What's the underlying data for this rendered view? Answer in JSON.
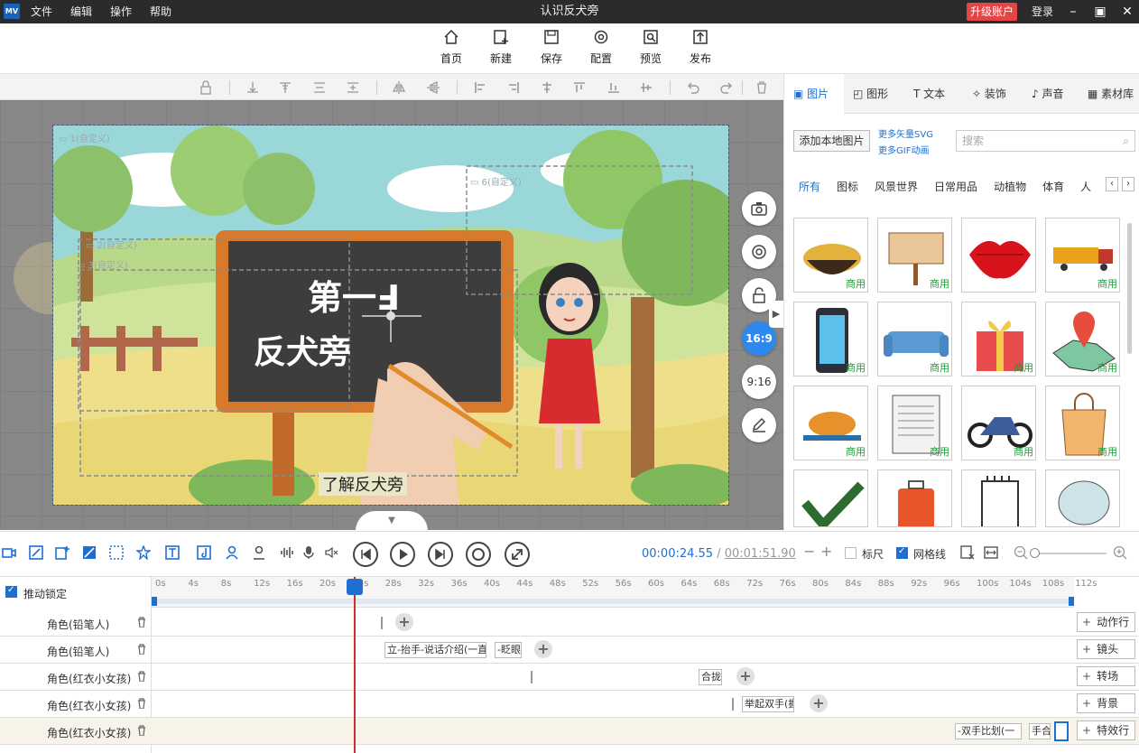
{
  "app": {
    "logo": "MV",
    "menu": [
      "文件",
      "编辑",
      "操作",
      "帮助"
    ],
    "window_title": "认识反犬旁",
    "upgrade_label": "升级账户",
    "login_label": "登录"
  },
  "toolbar": {
    "items": [
      {
        "label": "首页",
        "icon": "home-icon"
      },
      {
        "label": "新建",
        "icon": "new-icon"
      },
      {
        "label": "保存",
        "icon": "save-icon"
      },
      {
        "label": "配置",
        "icon": "settings-icon"
      },
      {
        "label": "预览",
        "icon": "preview-icon"
      },
      {
        "label": "发布",
        "icon": "publish-icon"
      }
    ]
  },
  "canvas": {
    "board_text_line1": "第一Ⅎ",
    "board_text_line2": "反犬旁",
    "subtitle": "了解反犬旁",
    "tags": {
      "t1": "1(自定义)",
      "t2": "2(自定义)",
      "t3": "3(自定义)",
      "t6": "6(自定义)"
    },
    "side_buttons": [
      "camera-icon",
      "rotate-icon",
      "lock-icon",
      "16:9",
      "9:16",
      "edit-icon"
    ],
    "ratio_active": "16:9",
    "ratio_other": "9:16"
  },
  "panel": {
    "tabs": [
      {
        "label": "图片",
        "icon": "image-icon"
      },
      {
        "label": "图形",
        "icon": "shape-icon"
      },
      {
        "label": "文本",
        "icon": "text-icon"
      },
      {
        "label": "装饰",
        "icon": "decoration-icon"
      },
      {
        "label": "声音",
        "icon": "sound-icon"
      },
      {
        "label": "素材库",
        "icon": "library-icon"
      }
    ],
    "add_local": "添加本地图片",
    "more_svg": "更多矢量SVG",
    "more_gif": "更多GIF动画",
    "search_placeholder": "搜索",
    "categories": [
      "所有",
      "图标",
      "风景世界",
      "日常用品",
      "动植物",
      "体育",
      "人"
    ],
    "commercial_badge": "商用",
    "thumbnails": [
      "noodles",
      "wooden-sign",
      "red-lips",
      "truck",
      "phone",
      "sofa",
      "gift-box",
      "map-pin",
      "roast-chicken",
      "papers",
      "motorcycle",
      "shopping-bag",
      "checkmark",
      "suitcase",
      "notepad",
      "chair"
    ]
  },
  "timeline_bar": {
    "current_time": "00:00:24.55",
    "separator": "/",
    "total_time": "00:01:51.90",
    "ruler_label": "标尺",
    "ruler_checked": false,
    "grid_label": "网格线",
    "grid_checked": true
  },
  "timeline": {
    "lock_label": "推动锁定",
    "ticks": [
      "0s",
      "4s",
      "8s",
      "12s",
      "16s",
      "20s",
      "24s",
      "28s",
      "32s",
      "36s",
      "40s",
      "44s",
      "48s",
      "52s",
      "56s",
      "60s",
      "64s",
      "68s",
      "72s",
      "76s",
      "80s",
      "84s",
      "88s",
      "92s",
      "96s",
      "100s",
      "104s",
      "108s",
      "112s"
    ],
    "tracks": [
      {
        "name": "角色(铅笔人)",
        "clips": []
      },
      {
        "name": "角色(铅笔人)",
        "clips": [
          "立-抬手-说话介绍(一直",
          "-眨眼"
        ]
      },
      {
        "name": "角色(红衣小女孩)",
        "clips": [
          "合拢"
        ]
      },
      {
        "name": "角色(红衣小女孩)",
        "clips": [
          "举起双手(握"
        ]
      },
      {
        "name": "角色(红衣小女孩)",
        "clips": [
          "-双手比划(一",
          "手合"
        ]
      }
    ],
    "add_buttons": [
      "动作行",
      "镜头",
      "转场",
      "背景",
      "特效行"
    ]
  }
}
